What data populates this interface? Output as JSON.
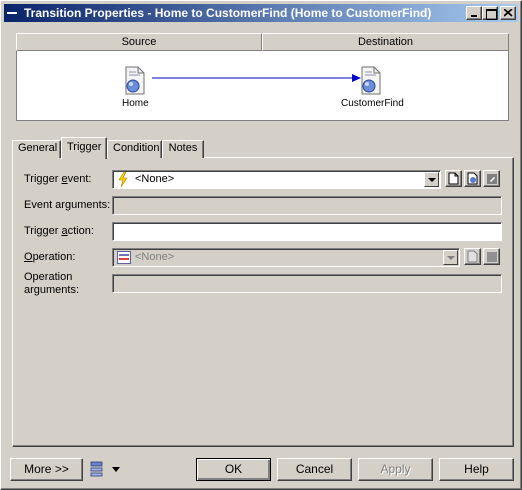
{
  "window": {
    "title": "Transition Properties - Home to CustomerFind (Home to CustomerFind)"
  },
  "diagram": {
    "source_header": "Source",
    "destination_header": "Destination",
    "source_node": "Home",
    "destination_node": "CustomerFind"
  },
  "tabs": [
    {
      "label": "General",
      "active": false
    },
    {
      "label": "Trigger",
      "active": true
    },
    {
      "label": "Condition",
      "active": false
    },
    {
      "label": "Notes",
      "active": false
    }
  ],
  "form": {
    "trigger_event": {
      "label_pre": "Trigger ",
      "label_u": "e",
      "label_post": "vent:",
      "value": "<None>"
    },
    "event_arguments": {
      "label": "Event arguments:",
      "value": ""
    },
    "trigger_action": {
      "label_pre": "Trigger ",
      "label_u": "a",
      "label_post": "ction:",
      "value": ""
    },
    "operation": {
      "label_pre": "",
      "label_u": "O",
      "label_post": "peration:",
      "value": "<None>"
    },
    "operation_arguments": {
      "label_line1": "Operation",
      "label_line2": "arguments:",
      "value": ""
    }
  },
  "footer": {
    "more_label": "More >>",
    "ok_label": "OK",
    "cancel_label": "Cancel",
    "apply_label": "Apply",
    "help_label": "Help"
  },
  "colors": {
    "titlebar_start": "#0a246a",
    "titlebar_end": "#a6caf0",
    "arrow": "#0000cc"
  },
  "icons": {
    "node": "state-node-icon",
    "trigger_event": "lightning-icon",
    "operation": "operation-icon"
  }
}
